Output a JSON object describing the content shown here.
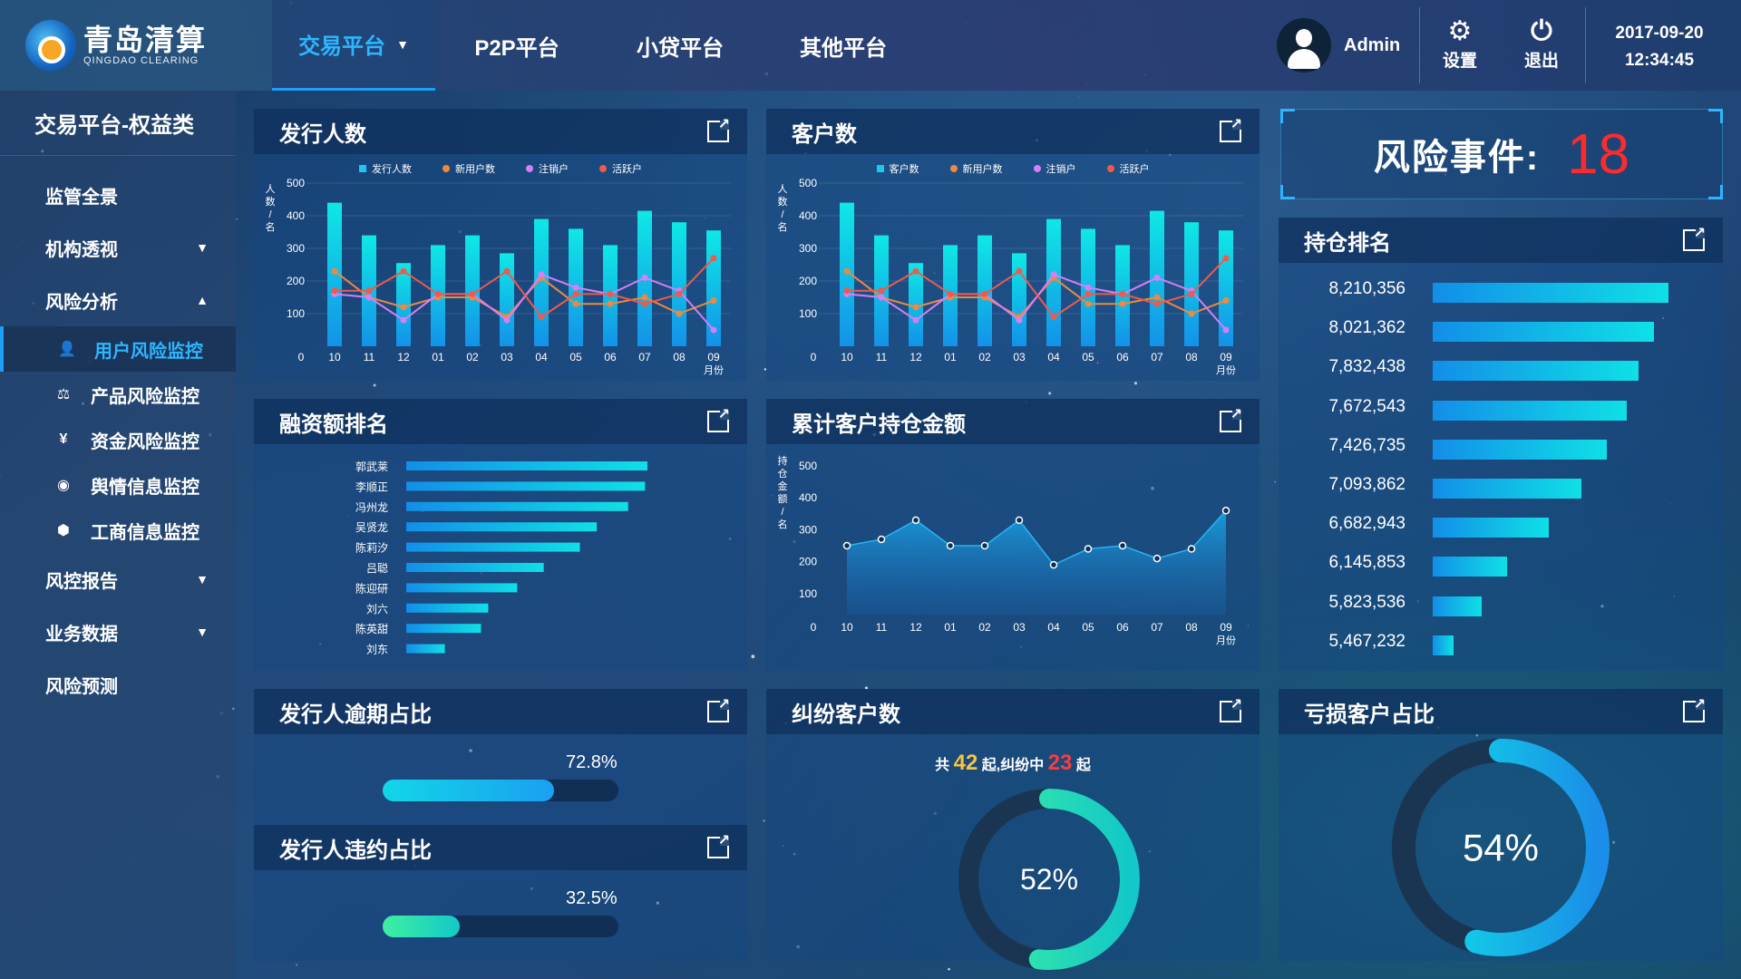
{
  "brand": {
    "name_cn": "青岛清算",
    "name_en": "QINGDAO CLEARING"
  },
  "nav": {
    "tabs": [
      {
        "label": "交易平台"
      },
      {
        "label": "P2P平台"
      },
      {
        "label": "小贷平台"
      },
      {
        "label": "其他平台"
      }
    ]
  },
  "user": {
    "name": "Admin",
    "settings_label": "设置",
    "logout_label": "退出"
  },
  "clock": {
    "date": "2017-09-20",
    "time": "12:34:45"
  },
  "sidebar": {
    "title": "交易平台-权益类",
    "items": [
      {
        "label": "监管全景",
        "icon": "",
        "expanded": null
      },
      {
        "label": "机构透视",
        "icon": "chevron-down",
        "expanded": false
      },
      {
        "label": "风险分析",
        "icon": "chevron-up",
        "expanded": true
      },
      {
        "label": "风控报告",
        "icon": "chevron-down",
        "expanded": false
      },
      {
        "label": "业务数据",
        "icon": "chevron-down",
        "expanded": false
      },
      {
        "label": "风险预测",
        "icon": "",
        "expanded": null
      }
    ],
    "subitems": [
      {
        "label": "用户风险监控",
        "icon": "user-icon",
        "active": true
      },
      {
        "label": "产品风险监控",
        "icon": "gavel-icon",
        "active": false
      },
      {
        "label": "资金风险监控",
        "icon": "yen-icon",
        "active": false
      },
      {
        "label": "舆情信息监控",
        "icon": "radio-icon",
        "active": false
      },
      {
        "label": "工商信息监控",
        "icon": "badge-icon",
        "active": false
      }
    ]
  },
  "panels": {
    "issuers": {
      "title": "发行人数"
    },
    "customers": {
      "title": "客户数"
    },
    "financing_rank": {
      "title": "融资额排名"
    },
    "holding_amount": {
      "title": "累计客户持仓金额"
    },
    "overdue": {
      "title": "发行人逾期占比"
    },
    "default": {
      "title": "发行人违约占比"
    },
    "disputes": {
      "title": "纠纷客户数"
    },
    "loss": {
      "title": "亏损客户占比"
    },
    "position_rank": {
      "title": "持仓排名"
    }
  },
  "risk": {
    "label": "风险事件:",
    "value": "18"
  },
  "colors": {
    "accent": "#2db6ff",
    "bar_start": "#138ee8",
    "bar_end": "#0fe0e6",
    "orange": "#f0883e",
    "purple": "#d77ef5",
    "red": "#f05a4a",
    "risk_red": "#ff2b2b",
    "green": "#3ef0a0",
    "gold": "#f5c542"
  },
  "chart_data": [
    {
      "type": "bar",
      "name": "issuers",
      "ylabel": "人数/名",
      "xlabel": "月份",
      "categories": [
        "10",
        "11",
        "12",
        "01",
        "02",
        "03",
        "04",
        "05",
        "06",
        "07",
        "08",
        "09"
      ],
      "ylim": [
        0,
        500
      ],
      "yticks": [
        "0",
        "100",
        "200",
        "300",
        "400",
        "500"
      ],
      "series": [
        {
          "name": "发行人数",
          "kind": "bar",
          "values": [
            440,
            340,
            255,
            310,
            340,
            285,
            390,
            360,
            310,
            415,
            380,
            355
          ]
        },
        {
          "name": "新用户数",
          "kind": "line",
          "values": [
            230,
            150,
            120,
            150,
            150,
            90,
            210,
            130,
            130,
            150,
            100,
            140
          ]
        },
        {
          "name": "注销户",
          "kind": "line",
          "values": [
            160,
            150,
            80,
            160,
            160,
            80,
            220,
            180,
            160,
            210,
            170,
            50
          ]
        },
        {
          "name": "活跃户",
          "kind": "line",
          "values": [
            170,
            170,
            230,
            160,
            160,
            230,
            90,
            160,
            160,
            130,
            160,
            270
          ]
        }
      ]
    },
    {
      "type": "bar",
      "name": "customers",
      "ylabel": "人数/名",
      "xlabel": "月份",
      "categories": [
        "10",
        "11",
        "12",
        "01",
        "02",
        "03",
        "04",
        "05",
        "06",
        "07",
        "08",
        "09"
      ],
      "ylim": [
        0,
        500
      ],
      "yticks": [
        "0",
        "100",
        "200",
        "300",
        "400",
        "500"
      ],
      "series": [
        {
          "name": "客户数",
          "kind": "bar",
          "values": [
            440,
            340,
            255,
            310,
            340,
            285,
            390,
            360,
            310,
            415,
            380,
            355
          ]
        },
        {
          "name": "新用户数",
          "kind": "line",
          "values": [
            230,
            150,
            120,
            150,
            150,
            90,
            210,
            130,
            130,
            150,
            100,
            140
          ]
        },
        {
          "name": "注销户",
          "kind": "line",
          "values": [
            160,
            150,
            80,
            160,
            160,
            80,
            220,
            180,
            160,
            210,
            170,
            50
          ]
        },
        {
          "name": "活跃户",
          "kind": "line",
          "values": [
            170,
            170,
            230,
            160,
            160,
            230,
            90,
            160,
            160,
            130,
            160,
            270
          ]
        }
      ]
    },
    {
      "type": "bar",
      "name": "financing_rank",
      "orientation": "horizontal",
      "categories": [
        "郭武莱",
        "李顺正",
        "冯州龙",
        "吴贤龙",
        "陈莉汐",
        "吕聪",
        "陈迎研",
        "刘六",
        "陈英甜",
        "刘东"
      ],
      "values": [
        100,
        99,
        92,
        79,
        72,
        57,
        46,
        34,
        31,
        16
      ]
    },
    {
      "type": "area",
      "name": "holding_amount",
      "ylabel": "持仓金额/名",
      "xlabel": "月份",
      "categories": [
        "10",
        "11",
        "12",
        "01",
        "02",
        "03",
        "04",
        "05",
        "06",
        "07",
        "08",
        "09"
      ],
      "ylim": [
        0,
        500
      ],
      "yticks": [
        "0",
        "100",
        "200",
        "300",
        "400",
        "500"
      ],
      "values": [
        250,
        270,
        330,
        250,
        250,
        330,
        190,
        240,
        250,
        210,
        240,
        360
      ]
    },
    {
      "type": "bar",
      "name": "position_rank",
      "orientation": "horizontal",
      "labels": [
        "8,210,356",
        "8,021,362",
        "7,832,438",
        "7,672,543",
        "7,426,735",
        "7,093,862",
        "6,682,943",
        "6,145,853",
        "5,823,536",
        "5,467,232"
      ],
      "values": [
        8210356,
        8021362,
        7832438,
        7672543,
        7426735,
        7093862,
        6682943,
        6145853,
        5823536,
        5467232
      ]
    },
    {
      "type": "bar",
      "name": "overdue",
      "value": 72.8,
      "label": "72.8%"
    },
    {
      "type": "bar",
      "name": "default",
      "value": 32.5,
      "label": "32.5%"
    },
    {
      "type": "pie",
      "name": "disputes",
      "total": "42",
      "dispute": "23",
      "value": 52,
      "label": "52%",
      "prefix": "共",
      "mid": "起,纠纷中",
      "suffix": "起"
    },
    {
      "type": "pie",
      "name": "loss",
      "value": 54,
      "label": "54%"
    }
  ]
}
